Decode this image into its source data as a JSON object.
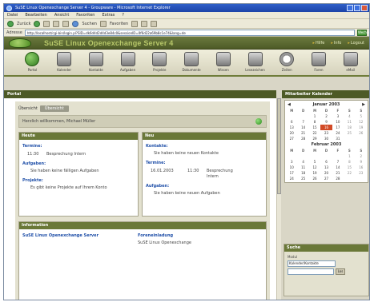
{
  "window": {
    "title": "SuSE Linux Openexchange Server 4 - Groupware - Microsoft Internet Explorer"
  },
  "menu": [
    "Datei",
    "Bearbeiten",
    "Ansicht",
    "Favoriten",
    "Extras",
    "?"
  ],
  "toolbar": {
    "back_label": "Zurück",
    "search_label": "Suchen",
    "favorites_label": "Favoriten"
  },
  "address": {
    "label": "Adresse",
    "url": "http://localhost/cgi-bin/login.pl?SID=dk6d4d2d4d3e84c0&sessionID=0f6d22a69b8c1e74&lang=de",
    "go_label": "Wechseln"
  },
  "app": {
    "title": "SuSE Linux Openexchange Server 4",
    "links": [
      "Hilfe",
      "Info",
      "Logout"
    ]
  },
  "modules": [
    {
      "label": "Portal",
      "icon": "portal-icon"
    },
    {
      "label": "Kalender",
      "icon": "calendar-icon"
    },
    {
      "label": "Kontakte",
      "icon": "contacts-icon"
    },
    {
      "label": "Aufgaben",
      "icon": "tasks-icon"
    },
    {
      "label": "Projekte",
      "icon": "projects-icon"
    },
    {
      "label": "Dokumente",
      "icon": "documents-icon"
    },
    {
      "label": "Wissen",
      "icon": "knowledge-icon"
    },
    {
      "label": "Lesezeichen",
      "icon": "bookmarks-icon"
    },
    {
      "label": "Zeiten",
      "icon": "times-icon"
    },
    {
      "label": "Foren",
      "icon": "forum-icon"
    },
    {
      "label": "eMail",
      "icon": "mail-icon"
    }
  ],
  "main": {
    "header": "Portal",
    "tab_label": "Übersicht",
    "tab_active": "Übersicht",
    "welcome": "Herzlich willkommen, Michael Müller",
    "left_panel": {
      "title": "Heute",
      "sections": [
        {
          "title": "Termine:",
          "time": "11:30",
          "desc": "Besprechung Intern"
        },
        {
          "title": "Aufgaben:",
          "note": "Sie haben keine fälligen Aufgaben"
        },
        {
          "title": "Projekte:",
          "note": "Es gibt keine Projekte auf Ihrem Konto"
        }
      ]
    },
    "right_panel": {
      "title": "Neu",
      "sections": [
        {
          "title": "Kontakte:",
          "note": "Sie haben keine neuen Kontakte"
        },
        {
          "title": "Termine:",
          "date": "16.01.2003",
          "time": "11:30",
          "desc": "Besprechung Intern"
        },
        {
          "title": "Aufgaben:",
          "note": "Sie haben keine neuen Aufgaben"
        }
      ]
    },
    "bottom_panel": {
      "title": "Information",
      "left_title": "SuSE Linux Openexchange Server",
      "right_title": "Foreneinladung",
      "right_note": "SuSE Linux Openexchange"
    }
  },
  "sidebar": {
    "calendar_header": "Mitarbeiter Kalender",
    "day_names": [
      "M",
      "D",
      "M",
      "D",
      "F",
      "S",
      "S"
    ],
    "months": [
      {
        "name": "Januar 2003",
        "days": [
          "",
          "",
          "1",
          "2",
          "3",
          "4",
          "5",
          "6",
          "7",
          "8",
          "9",
          "10",
          "11",
          "12",
          "13",
          "14",
          "15",
          "16",
          "17",
          "18",
          "19",
          "20",
          "21",
          "22",
          "23",
          "24",
          "25",
          "26",
          "27",
          "28",
          "29",
          "30",
          "31",
          "",
          ""
        ],
        "today": "16"
      },
      {
        "name": "Februar 2003",
        "days": [
          "",
          "",
          "",
          "",
          "",
          "1",
          "2",
          "3",
          "4",
          "5",
          "6",
          "7",
          "8",
          "9",
          "10",
          "11",
          "12",
          "13",
          "14",
          "15",
          "16",
          "17",
          "18",
          "19",
          "20",
          "21",
          "22",
          "23",
          "24",
          "25",
          "26",
          "27",
          "28",
          "",
          ""
        ]
      }
    ],
    "search": {
      "header": "Suche",
      "label": "Modul",
      "select_value": "Kalender/Kontakte",
      "go_label": "Los"
    }
  }
}
